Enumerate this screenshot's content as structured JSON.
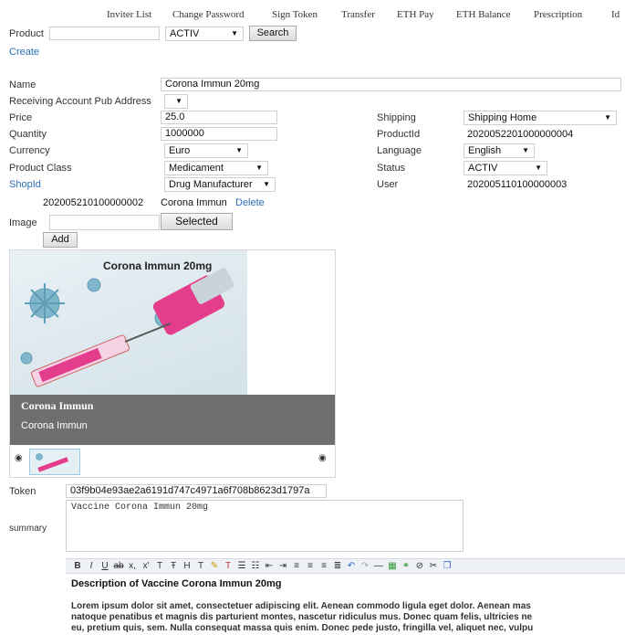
{
  "nav": [
    "Inviter List",
    "Change Password",
    "Sign Token",
    "Transfer",
    "ETH Pay",
    "ETH Balance",
    "Prescription",
    "Id"
  ],
  "search": {
    "label": "Product",
    "status": "ACTIV",
    "button": "Search",
    "create": "Create"
  },
  "form": {
    "name_label": "Name",
    "name_value": "Corona Immun 20mg",
    "receiving_label": "Receiving Account Pub Address",
    "price_label": "Price",
    "price_value": "25.0",
    "quantity_label": "Quantity",
    "quantity_value": "1000000",
    "currency_label": "Currency",
    "currency_value": "Euro",
    "class_label": "Product Class",
    "class_value": "Medicament",
    "shop_label": "ShopId",
    "shop_value": "Drug Manufacturer",
    "shipping_label": "Shipping",
    "shipping_value": "Shipping Home",
    "productid_label": "ProductId",
    "productid_value": "2020052201000000004",
    "language_label": "Language",
    "language_value": "English",
    "status_label": "Status",
    "status_value": "ACTIV",
    "user_label": "User",
    "user_value": "202005110100000003"
  },
  "image_row": {
    "id": "202005210100000002",
    "name": "Corona Immun",
    "delete": "Delete",
    "label": "Image",
    "selected": "Selected",
    "add": "Add"
  },
  "slide": {
    "image_title": "Corona Immun 20mg",
    "caption_title": "Corona Immun",
    "caption_text": "Corona Immun"
  },
  "token": {
    "label": "Token",
    "value": "03f9b04e93ae2a6191d747c4971a6f708b8623d1797a"
  },
  "summary": {
    "label": "summary",
    "value": "Vaccine Corona Immun 20mg"
  },
  "editor": {
    "heading": "Description of Vaccine Corona Immun 20mg",
    "line1": "Lorem ipsum dolor sit amet, consectetuer adipiscing elit. Aenean commodo ligula eget dolor. Aenean mas",
    "line2": "natoque penatibus et magnis dis parturient montes, nascetur ridiculus mus. Donec quam felis, ultricies ne",
    "line3": "eu, pretium quis, sem. Nulla consequat massa quis enim. Donec pede justo, fringilla vel, aliquet nec, vulpu"
  },
  "colors": {
    "link": "#2a6db6",
    "caption_bg": "#6f6f6f",
    "image_bg": "#dce8ee",
    "syringe_pink": "#e33d8c",
    "virus": "#7fb6cc"
  }
}
